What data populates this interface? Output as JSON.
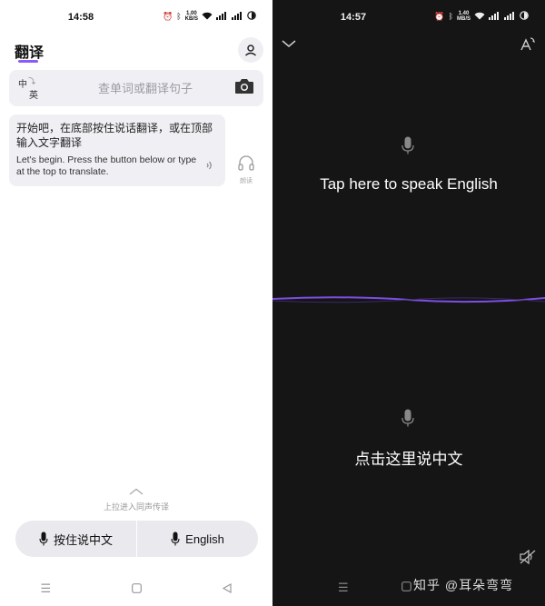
{
  "left": {
    "status": {
      "time": "14:58",
      "speed_top": "1.00",
      "speed_bottom": "KB/S"
    },
    "header": {
      "title": "翻译"
    },
    "search": {
      "lang_from": "中",
      "lang_to": "英",
      "placeholder": "查单词或翻译句子"
    },
    "bubble": {
      "zh": "开始吧，在底部按住说话翻译，或在顶部输入文字翻译",
      "en": "Let's begin. Press the button below or type at the top to translate."
    },
    "listen_label": "朗读",
    "pull_hint": "上拉进入同声传译",
    "bottom": {
      "zh_button": "按住说中文",
      "en_button": "English"
    }
  },
  "right": {
    "status": {
      "time": "14:57",
      "speed_top": "1.40",
      "speed_bottom": "MB/S"
    },
    "en_prompt": "Tap here to speak English",
    "zh_prompt": "点击这里说中文",
    "watermark": "知乎 @耳朵弯弯"
  },
  "colors": {
    "accent": "#8a5cf6",
    "dark_bg": "#151515",
    "surface": "#f0f0f4"
  }
}
